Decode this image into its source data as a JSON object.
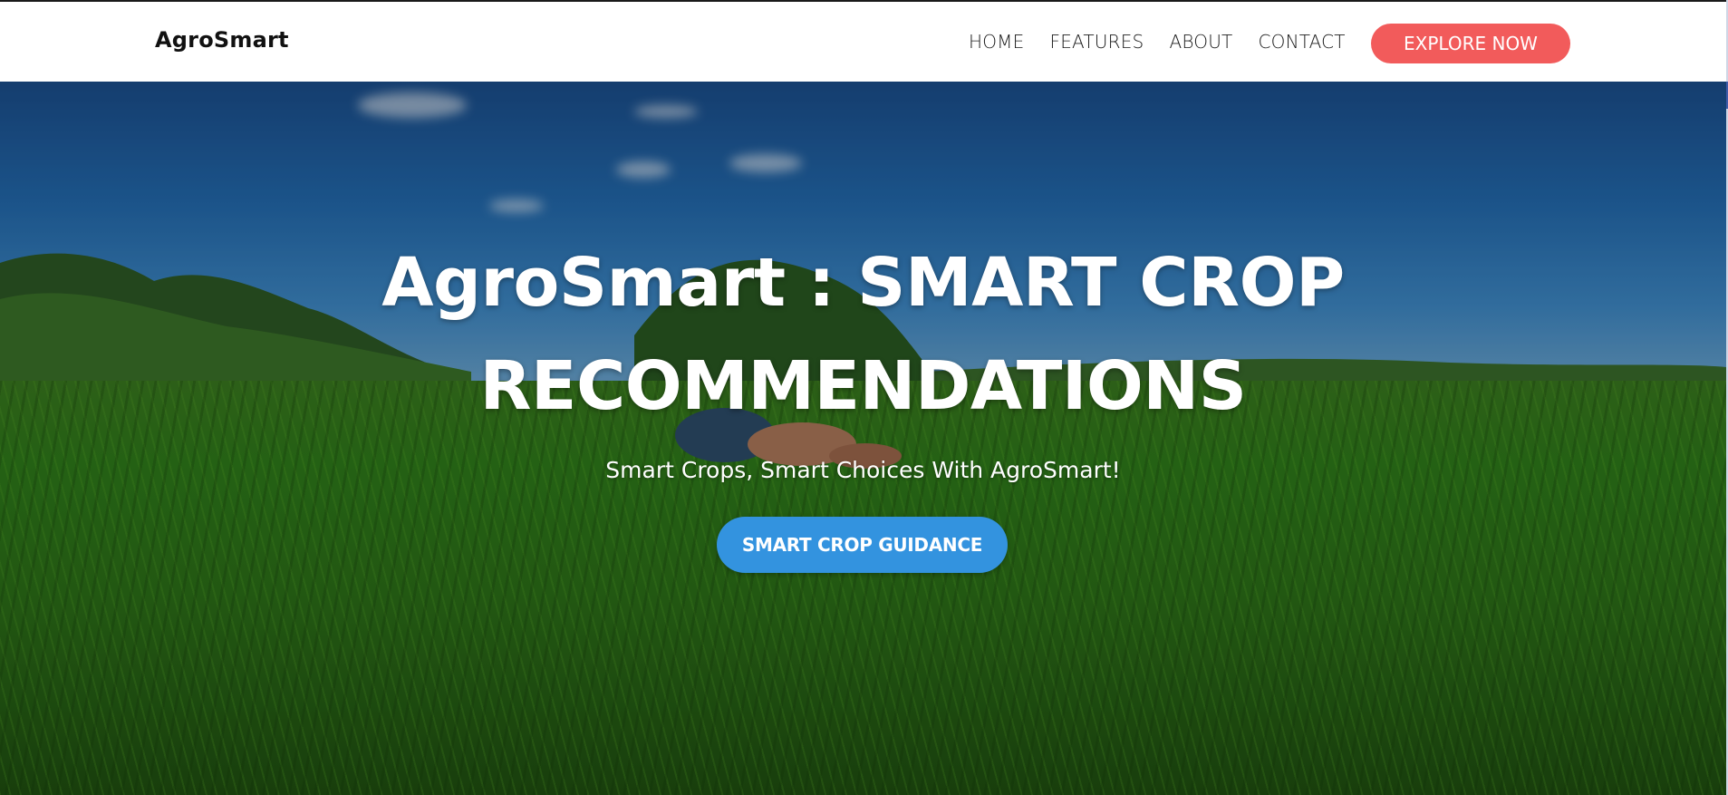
{
  "navbar": {
    "brand": "AgroSmart",
    "links": [
      {
        "label": "HOME"
      },
      {
        "label": "FEATURES"
      },
      {
        "label": "ABOUT"
      },
      {
        "label": "CONTACT"
      }
    ],
    "cta_label": "EXPLORE NOW"
  },
  "hero": {
    "title_line1": "AgroSmart : SMART CROP",
    "title_line2": "RECOMMENDATIONS",
    "subtitle": "Smart Crops, Smart Choices With AgroSmart!",
    "cta_label": "SMART CROP GUIDANCE",
    "background_image": "farmer-in-green-rice-field-photo"
  },
  "colors": {
    "explore_button": "#f25b5b",
    "guidance_button": "#3393df",
    "nav_text": "#1a1a1a",
    "hero_text": "#ffffff"
  }
}
